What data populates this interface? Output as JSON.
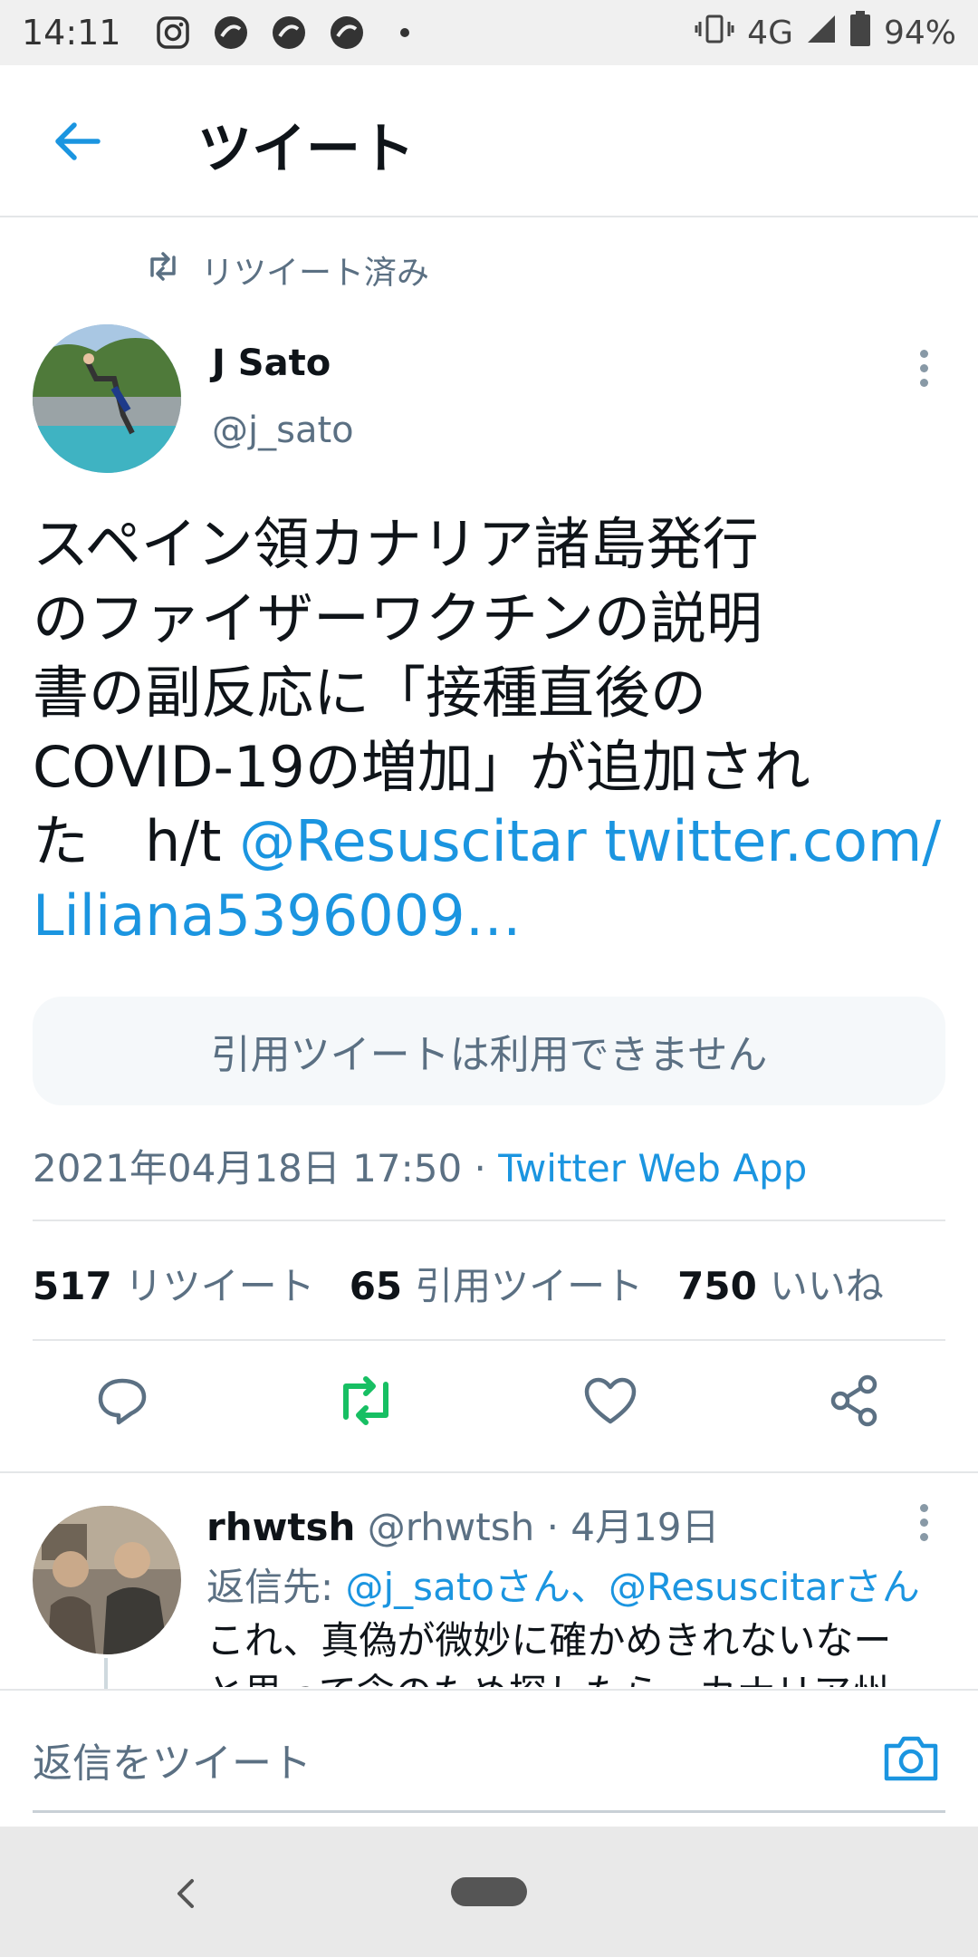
{
  "status_bar": {
    "time": "14:11",
    "network": "4G",
    "battery": "94%"
  },
  "header": {
    "title": "ツイート"
  },
  "tweet": {
    "retweeted_label": "リツイート済み",
    "author_name": "J Sato",
    "author_handle": "@j_sato",
    "text_lines": [
      "スペイン領カナリア諸島発行",
      "のファイザーワクチンの説明",
      "書の副反応に「接種直後の",
      "COVID-19の増加」が追加され"
    ],
    "text_line5_prefix": "た　h/t ",
    "mention": "@Resuscitar",
    "link_part1": "twitter.com/",
    "link_part2": "Liliana5396009…",
    "quote_unavailable": "引用ツイートは利用できません",
    "timestamp": "2021年04月18日 17:50",
    "separator": " · ",
    "source": "Twitter Web App"
  },
  "stats": {
    "retweets_count": "517",
    "retweets_label": "リツイート",
    "quotes_count": "65",
    "quotes_label": "引用ツイート",
    "likes_count": "750",
    "likes_label": "いいね"
  },
  "reply": {
    "name": "rhwtsh",
    "handle": "@rhwtsh",
    "separator": " · ",
    "date": "4月19日",
    "reply_to_label": "返信先:",
    "reply_to_users": "@j_satoさん、@Resuscitarさん",
    "text": "これ、真偽が微妙に確かめきれないなー",
    "text_line2": "と思って念のため探したら、カナリア州"
  },
  "compose": {
    "placeholder": "返信をツイート"
  },
  "colors": {
    "accent": "#1b95e0",
    "retweet_active": "#17bf63",
    "muted": "#5b7083"
  },
  "icons": {
    "back": "arrow-left-icon",
    "retweet_small": "retweet-icon",
    "more": "more-vertical-icon",
    "reply": "reply-icon",
    "retweet": "retweet-icon",
    "like": "heart-icon",
    "share": "share-icon",
    "camera": "camera-icon"
  }
}
